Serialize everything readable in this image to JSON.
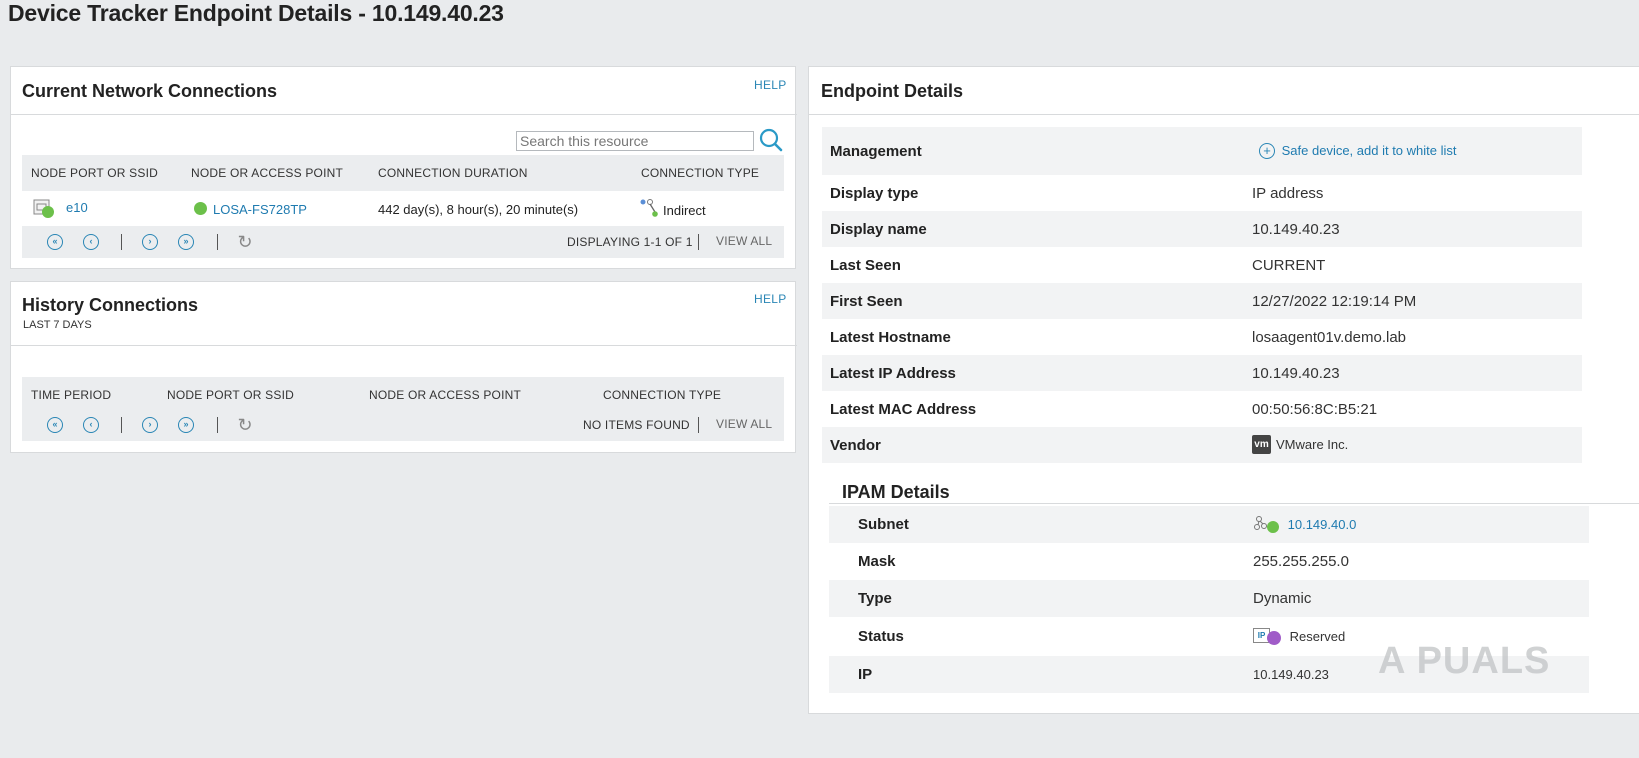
{
  "page": {
    "title": "Device Tracker Endpoint Details - 10.149.40.23"
  },
  "current_connections": {
    "title": "Current Network Connections",
    "help": "HELP",
    "search_placeholder": "Search this resource",
    "columns": [
      "NODE PORT OR SSID",
      "NODE OR ACCESS POINT",
      "CONNECTION DURATION",
      "CONNECTION TYPE"
    ],
    "row": {
      "port": "e10",
      "node": "LOSA-FS728TP",
      "duration": "442 day(s), 8 hour(s), 20 minute(s)",
      "type": "Indirect"
    },
    "pager_info": "DISPLAYING 1-1 OF 1",
    "view_all": "VIEW ALL"
  },
  "history_connections": {
    "title": "History Connections",
    "subtitle": "LAST 7 DAYS",
    "help": "HELP",
    "columns": [
      "TIME PERIOD",
      "NODE PORT OR SSID",
      "NODE OR ACCESS POINT",
      "CONNECTION TYPE"
    ],
    "pager_info": "NO ITEMS FOUND",
    "view_all": "VIEW ALL"
  },
  "endpoint_details": {
    "title": "Endpoint Details",
    "management_label": "Management",
    "management_action": "Safe device, add it to white list",
    "rows": [
      {
        "label": "Display type",
        "value": "IP address"
      },
      {
        "label": "Display name",
        "value": "10.149.40.23"
      },
      {
        "label": "Last Seen",
        "value": "CURRENT"
      },
      {
        "label": "First Seen",
        "value": "12/27/2022 12:19:14 PM"
      },
      {
        "label": "Latest Hostname",
        "value": "losaagent01v.demo.lab"
      },
      {
        "label": "Latest IP Address",
        "value": "10.149.40.23"
      },
      {
        "label": "Latest MAC Address",
        "value": "00:50:56:8C:B5:21"
      },
      {
        "label": "Vendor",
        "value": "VMware Inc.",
        "icon_text": "vm"
      }
    ]
  },
  "ipam_details": {
    "title": "IPAM Details",
    "rows": [
      {
        "label": "Subnet",
        "value": "10.149.40.0"
      },
      {
        "label": "Mask",
        "value": "255.255.255.0"
      },
      {
        "label": "Type",
        "value": "Dynamic"
      },
      {
        "label": "Status",
        "value": "Reserved",
        "icon_text": "IP"
      },
      {
        "label": "IP",
        "value": "10.149.40.23"
      }
    ]
  },
  "watermark": "A PUALS",
  "colors": {
    "link": "#1f7bb0",
    "status_up": "#6cc04a",
    "reserved": "#a05cc8"
  }
}
